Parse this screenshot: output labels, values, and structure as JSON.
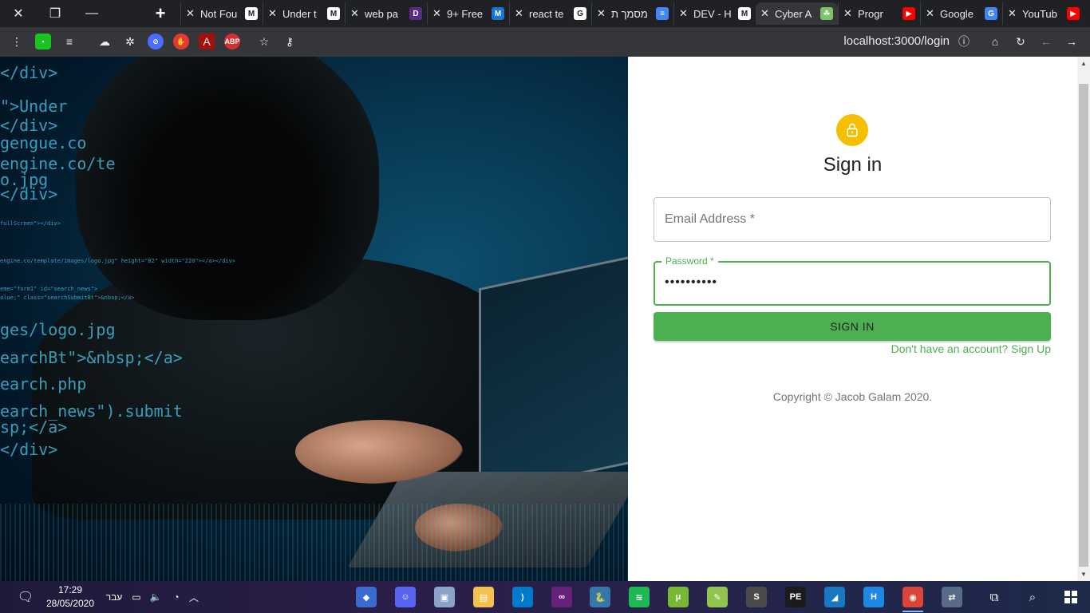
{
  "browser": {
    "tabs": [
      {
        "title": "Not Fou",
        "icon": "medium-icon",
        "icon_text": "M",
        "color": "#ffffff"
      },
      {
        "title": "Under t",
        "icon": "medium-icon",
        "icon_text": "M",
        "color": "#ffffff"
      },
      {
        "title": "web pa",
        "icon": "devto-icon",
        "icon_text": "D",
        "color": "#5b2a86"
      },
      {
        "title": "9+ Free",
        "icon": "mui-icon",
        "icon_text": "M",
        "color": "#1976d2"
      },
      {
        "title": "react te",
        "icon": "google-icon",
        "icon_text": "G",
        "color": "#ffffff"
      },
      {
        "title": "מסמך ת",
        "icon": "docs-icon",
        "icon_text": "≡",
        "color": "#4285f4"
      },
      {
        "title": "DEV - H",
        "icon": "gmail-icon",
        "icon_text": "M",
        "color": "#ffffff"
      },
      {
        "title": "Cyber A",
        "icon": "cyber-icon",
        "icon_text": "☘",
        "color": "#7cc26d",
        "active": true
      },
      {
        "title": "Progr",
        "icon": "youtube-icon",
        "icon_text": "▶",
        "color": "#ff0000"
      },
      {
        "title": "Google",
        "icon": "translate-icon",
        "icon_text": "G",
        "color": "#4285f4"
      },
      {
        "title": "YouTub",
        "icon": "youtube-icon",
        "icon_text": "▶",
        "color": "#ff0000"
      }
    ],
    "url": "localhost:3000/login"
  },
  "login": {
    "title": "Sign in",
    "email_label": "Email Address *",
    "password_label": "Password *",
    "password_value": "••••••••••",
    "signin_button": "SIGN IN",
    "signup_link": "Don't have an account? Sign Up",
    "copyright": "Copyright © Jacob Galam 2020."
  },
  "hero": {
    "code_lines": [
      "</div>",
      "\">Under",
      "</div>",
      "gengue.co",
      "engine.co/te",
      "o.jpg",
      "</div>",
      "fullScreen\"></div>",
      "engine.co/template/images/logo.jpg\" height=\"82\" width=\"220\"></a></div>",
      "eme=\"form1\" id=\"search_news\">",
      "alue;\" class=\"searchSubmitBt\">&nbsp;</a>",
      "ges/logo.jpg",
      "earchBt\">&nbsp;</a>",
      "earch.php",
      "earch_news\").submit",
      "sp;</a>",
      "</div>"
    ]
  },
  "taskbar": {
    "time": "17:29",
    "date": "28/05/2020",
    "lang": "עבר",
    "apps": [
      {
        "name": "git-icon",
        "text": "◆",
        "color": "#3a6bd0"
      },
      {
        "name": "discord-icon",
        "text": "☺",
        "color": "#5865f2"
      },
      {
        "name": "photos-icon",
        "text": "▣",
        "color": "#8aa4c8"
      },
      {
        "name": "explorer-icon",
        "text": "▤",
        "color": "#f2c14e"
      },
      {
        "name": "vscode-icon",
        "text": "⟩",
        "color": "#007acc"
      },
      {
        "name": "visual-studio-icon",
        "text": "∞",
        "color": "#68217a"
      },
      {
        "name": "python-icon",
        "text": "🐍",
        "color": "#3776ab"
      },
      {
        "name": "spotify-icon",
        "text": "≋",
        "color": "#1db954"
      },
      {
        "name": "utorrent-icon",
        "text": "μ",
        "color": "#78b832"
      },
      {
        "name": "notepad-plus-icon",
        "text": "✎",
        "color": "#90c44c"
      },
      {
        "name": "sublime-icon",
        "text": "S",
        "color": "#4b4b4b"
      },
      {
        "name": "pycharm-icon",
        "text": "PE",
        "color": "#1b1b1b"
      },
      {
        "name": "shark-icon",
        "text": "◢",
        "color": "#1679c2"
      },
      {
        "name": "h-app-icon",
        "text": "H",
        "color": "#1e88e5"
      },
      {
        "name": "chrome-icon",
        "text": "◉",
        "color": "#db4437",
        "active": true
      },
      {
        "name": "network-tool-icon",
        "text": "⇄",
        "color": "#5a6b8a"
      }
    ]
  }
}
